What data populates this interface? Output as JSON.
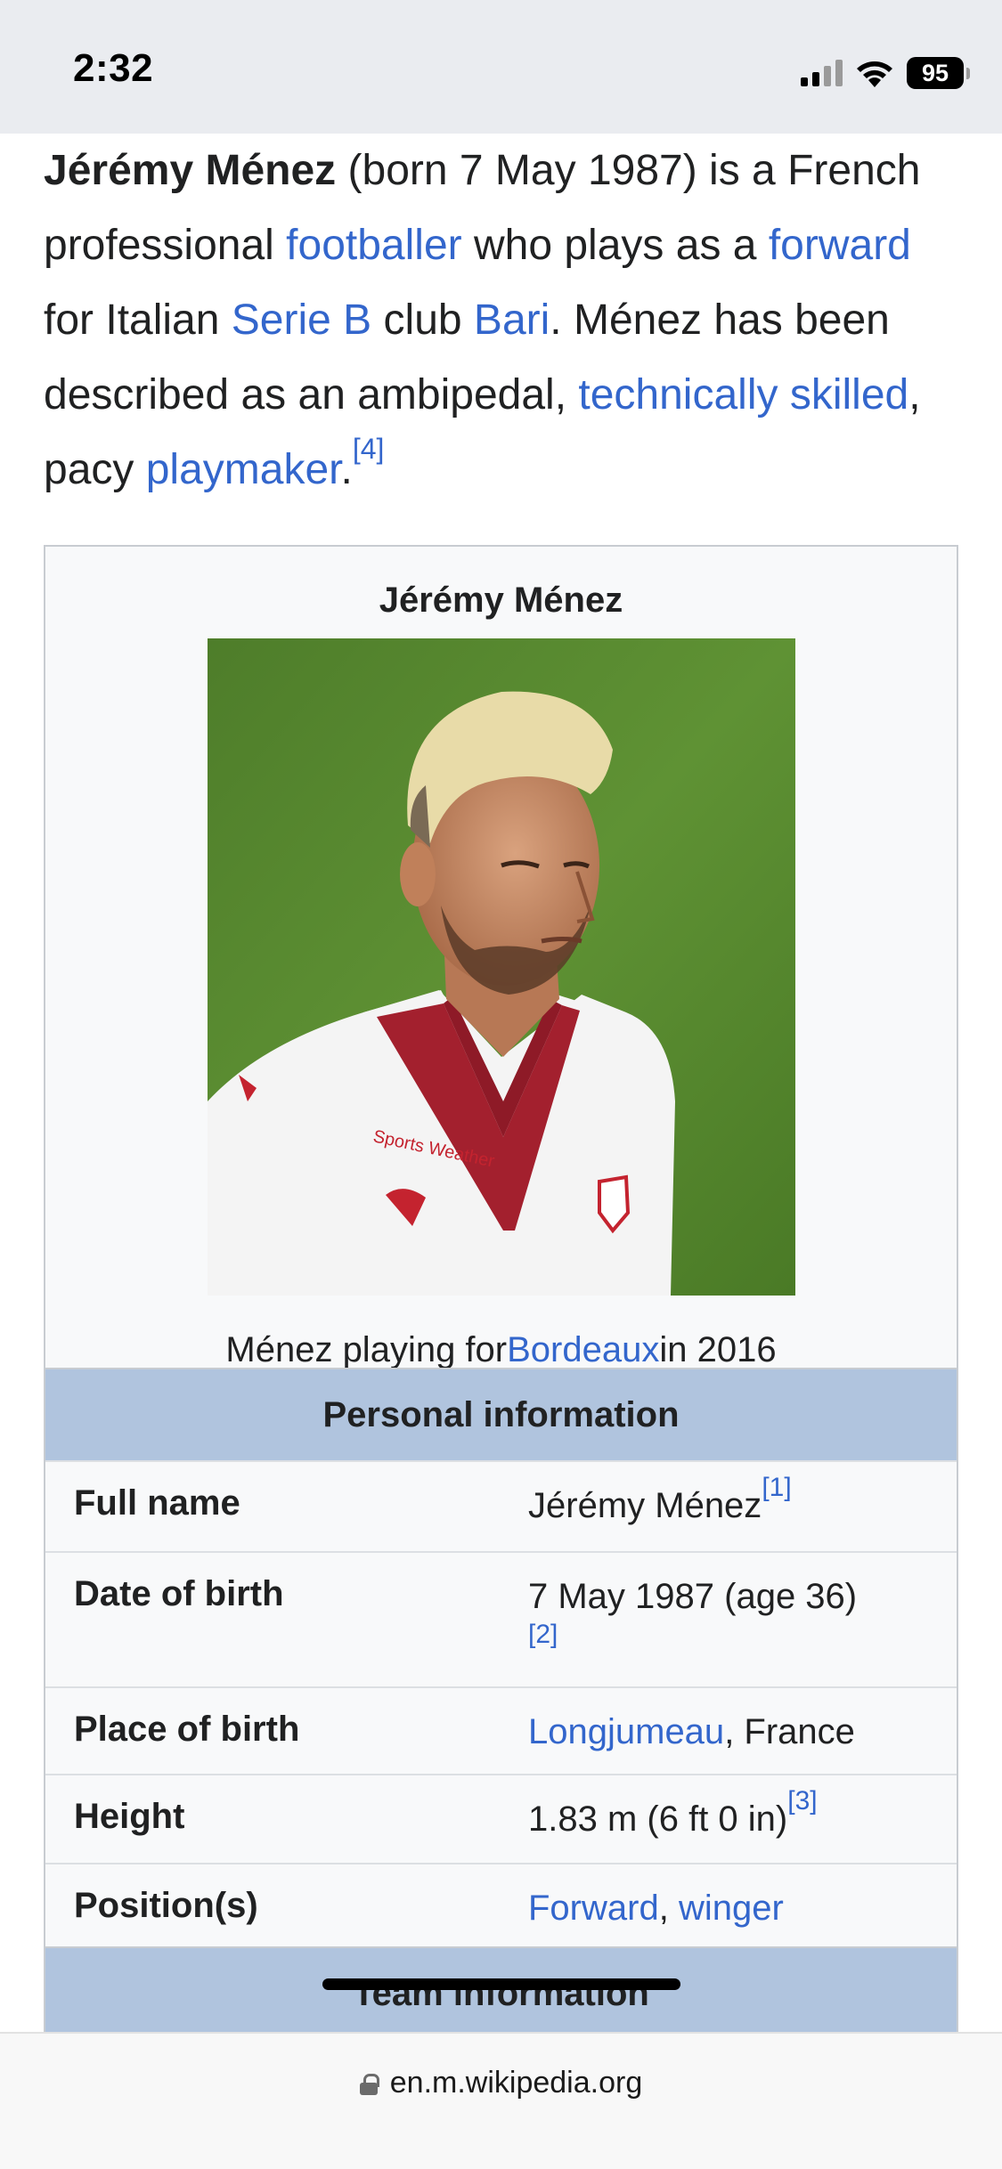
{
  "status_bar": {
    "time": "2:32",
    "battery": "95"
  },
  "intro": {
    "subject": "Jérémy Ménez",
    "t1": " (born 7 May 1987) is a French professional ",
    "link_footballer": "footballer",
    "t2": " who plays as a ",
    "link_forward": "forward",
    "t3": " for Italian ",
    "link_serie_b": "Serie B",
    "t4": " club ",
    "link_bari": "Bari",
    "t5": ". Ménez has been described as an ambipedal, ",
    "link_technically_skilled": "technically skilled",
    "t6": ", pacy ",
    "link_playmaker": "playmaker",
    "t7": ".",
    "ref": "[4]"
  },
  "infobox": {
    "title": "Jérémy Ménez",
    "caption": {
      "before": "Ménez playing for ",
      "link": "Bordeaux",
      "after": " in 2016"
    },
    "jersey_sponsor": "Sports Weather",
    "personal_header": "Personal information",
    "rows": [
      {
        "label": "Full name",
        "value": "Jérémy Ménez",
        "ref": "[1]"
      },
      {
        "label": "Date of birth",
        "value": "7 May 1987 (age 36)",
        "ref": "[2]"
      },
      {
        "label": "Place of birth",
        "link": "Longjumeau",
        "value_after": ", France"
      },
      {
        "label": "Height",
        "value": "1.83 m (6 ft 0 in)",
        "ref": "[3]"
      },
      {
        "label": "Position(s)",
        "link1": "Forward",
        "sep": ", ",
        "link2": "winger"
      }
    ],
    "team_header": "Team information"
  },
  "browser": {
    "url": "en.m.wikipedia.org"
  },
  "colors": {
    "link": "#3366cc",
    "infobox_header": "#b0c4de",
    "infobox_bg": "#f8f9fa"
  }
}
